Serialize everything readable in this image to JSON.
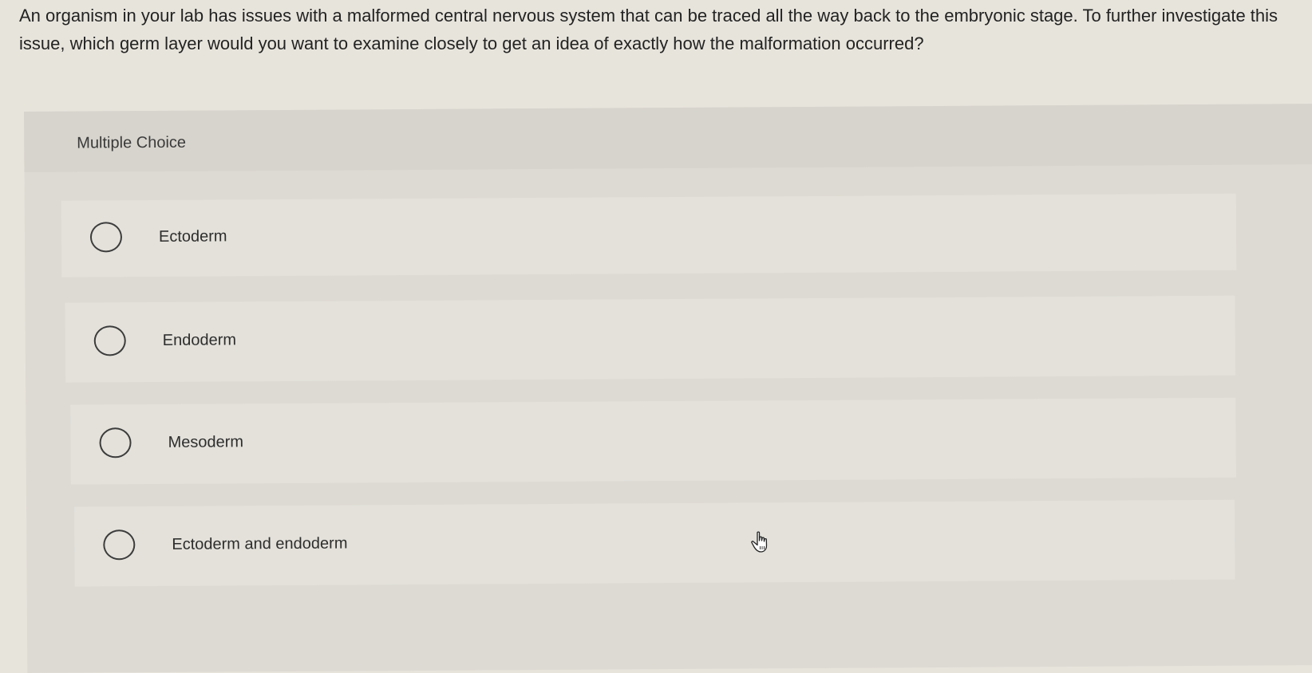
{
  "question": {
    "text": "An organism in your lab has issues with a malformed central nervous system that can be traced all the way back to the embryonic stage. To further investigate this issue, which germ layer would you want to examine closely to get an idea of exactly how the malformation occurred?"
  },
  "multiple_choice": {
    "label": "Multiple Choice",
    "options": [
      {
        "label": "Ectoderm",
        "selected": false
      },
      {
        "label": "Endoderm",
        "selected": false
      },
      {
        "label": "Mesoderm",
        "selected": false
      },
      {
        "label": "Ectoderm and endoderm",
        "selected": false
      }
    ]
  },
  "cursor": {
    "icon": "hand-pointer-icon"
  }
}
